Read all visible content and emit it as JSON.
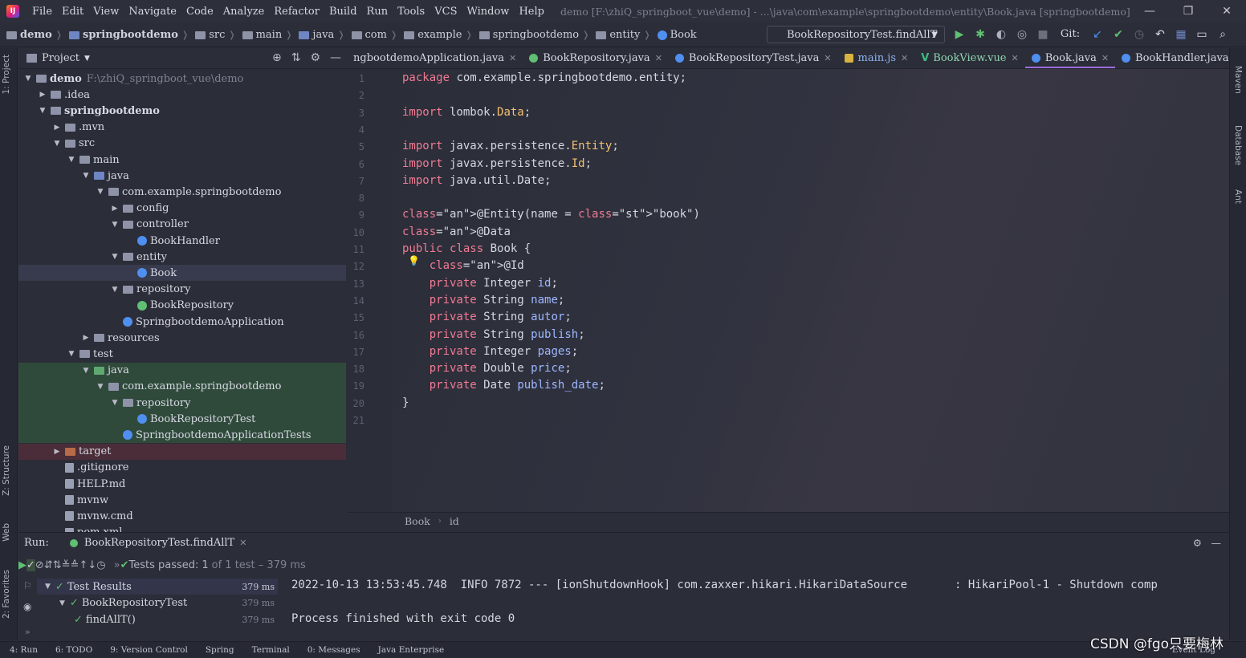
{
  "menu": [
    "File",
    "Edit",
    "View",
    "Navigate",
    "Code",
    "Analyze",
    "Refactor",
    "Build",
    "Run",
    "Tools",
    "VCS",
    "Window",
    "Help"
  ],
  "window_title": "demo [F:\\zhiQ_springboot_vue\\demo] - ...\\java\\com\\example\\springbootdemo\\entity\\Book.java [springbootdemo]",
  "breadcrumbs": [
    "demo",
    "springbootdemo",
    "src",
    "main",
    "java",
    "com",
    "example",
    "springbootdemo",
    "entity",
    "Book"
  ],
  "run_config": "BookRepositoryTest.findAllT",
  "git_label": "Git:",
  "project": {
    "title": "Project",
    "tree": [
      {
        "name": "demo",
        "extra": "F:\\zhiQ_springboot_vue\\demo",
        "depth": 0,
        "arrow": "open",
        "icon": "folder",
        "bold": true
      },
      {
        "name": ".idea",
        "depth": 1,
        "arrow": "closed",
        "icon": "folder"
      },
      {
        "name": "springbootdemo",
        "depth": 1,
        "arrow": "open",
        "icon": "folder",
        "bold": true
      },
      {
        "name": ".mvn",
        "depth": 2,
        "arrow": "closed",
        "icon": "folder"
      },
      {
        "name": "src",
        "depth": 2,
        "arrow": "open",
        "icon": "folder"
      },
      {
        "name": "main",
        "depth": 3,
        "arrow": "open",
        "icon": "folder"
      },
      {
        "name": "java",
        "depth": 4,
        "arrow": "open",
        "icon": "src"
      },
      {
        "name": "com.example.springbootdemo",
        "depth": 5,
        "arrow": "open",
        "icon": "folder"
      },
      {
        "name": "config",
        "depth": 6,
        "arrow": "closed",
        "icon": "folder"
      },
      {
        "name": "controller",
        "depth": 6,
        "arrow": "open",
        "icon": "folder"
      },
      {
        "name": "BookHandler",
        "depth": 7,
        "arrow": "none",
        "icon": "c"
      },
      {
        "name": "entity",
        "depth": 6,
        "arrow": "open",
        "icon": "folder"
      },
      {
        "name": "Book",
        "depth": 7,
        "arrow": "none",
        "icon": "c",
        "state": "sel"
      },
      {
        "name": "repository",
        "depth": 6,
        "arrow": "open",
        "icon": "folder"
      },
      {
        "name": "BookRepository",
        "depth": 7,
        "arrow": "none",
        "icon": "i"
      },
      {
        "name": "SpringbootdemoApplication",
        "depth": 6,
        "arrow": "none",
        "icon": "c"
      },
      {
        "name": "resources",
        "depth": 4,
        "arrow": "closed",
        "icon": "folder"
      },
      {
        "name": "test",
        "depth": 3,
        "arrow": "open",
        "icon": "folder"
      },
      {
        "name": "java",
        "depth": 4,
        "arrow": "open",
        "icon": "test",
        "state": "green"
      },
      {
        "name": "com.example.springbootdemo",
        "depth": 5,
        "arrow": "open",
        "icon": "folder",
        "state": "green"
      },
      {
        "name": "repository",
        "depth": 6,
        "arrow": "open",
        "icon": "folder",
        "state": "green"
      },
      {
        "name": "BookRepositoryTest",
        "depth": 7,
        "arrow": "none",
        "icon": "c",
        "state": "green"
      },
      {
        "name": "SpringbootdemoApplicationTests",
        "depth": 6,
        "arrow": "none",
        "icon": "c",
        "state": "green"
      },
      {
        "name": "target",
        "depth": 2,
        "arrow": "closed",
        "icon": "tgt",
        "state": "red"
      },
      {
        "name": ".gitignore",
        "depth": 2,
        "arrow": "none",
        "icon": "file"
      },
      {
        "name": "HELP.md",
        "depth": 2,
        "arrow": "none",
        "icon": "file"
      },
      {
        "name": "mvnw",
        "depth": 2,
        "arrow": "none",
        "icon": "file"
      },
      {
        "name": "mvnw.cmd",
        "depth": 2,
        "arrow": "none",
        "icon": "file"
      },
      {
        "name": "pom.xml",
        "depth": 2,
        "arrow": "none",
        "icon": "file"
      }
    ]
  },
  "tabs": [
    {
      "label": "ngbootdemoApplication.java",
      "icon": "none"
    },
    {
      "label": "BookRepository.java",
      "icon": "i"
    },
    {
      "label": "BookRepositoryTest.java",
      "icon": "c"
    },
    {
      "label": "main.js",
      "icon": "js"
    },
    {
      "label": "BookView.vue",
      "icon": "vue"
    },
    {
      "label": "Book.java",
      "icon": "c",
      "active": true
    },
    {
      "label": "BookHandler.java",
      "icon": "c"
    }
  ],
  "code_lines": [
    "package com.example.springbootdemo.entity;",
    "",
    "import lombok.Data;",
    "",
    "import javax.persistence.Entity;",
    "import javax.persistence.Id;",
    "import java.util.Date;",
    "",
    "@Entity(name = \"book\")",
    "@Data",
    "public class Book {",
    "    @Id",
    "    private Integer id;",
    "    private String name;",
    "    private String autor;",
    "    private String publish;",
    "    private Integer pages;",
    "    private Double price;",
    "    private Date publish_date;",
    "}",
    ""
  ],
  "editor_breadcrumb": [
    "Book",
    "id"
  ],
  "run": {
    "label": "Run:",
    "tab": "BookRepositoryTest.findAllT",
    "status_prefix": "Tests passed:",
    "status_count": "1",
    "status_suffix": "of 1 test – 379 ms",
    "tests": [
      {
        "name": "Test Results",
        "ms": "379 ms",
        "depth": 0
      },
      {
        "name": "BookRepositoryTest",
        "ms": "379 ms",
        "depth": 1
      },
      {
        "name": "findAllT()",
        "ms": "379 ms",
        "depth": 2
      }
    ],
    "console": [
      "2022-10-13 13:53:45.748  INFO 7872 --- [ionShutdownHook] com.zaxxer.hikari.HikariDataSource       : HikariPool-1 - Shutdown comp",
      "",
      "Process finished with exit code 0"
    ]
  },
  "left_tool_tabs": [
    "1: Project",
    "Z: Structure",
    "Web",
    "2: Favorites"
  ],
  "right_tool_tabs": [
    "Maven",
    "Database",
    "Ant"
  ],
  "status_tabs": [
    "4: Run",
    "6: TODO",
    "9: Version Control",
    "Spring",
    "Terminal",
    "0: Messages",
    "Java Enterprise"
  ],
  "event_log": "Event Log",
  "watermark": "CSDN @fgo只要梅林"
}
